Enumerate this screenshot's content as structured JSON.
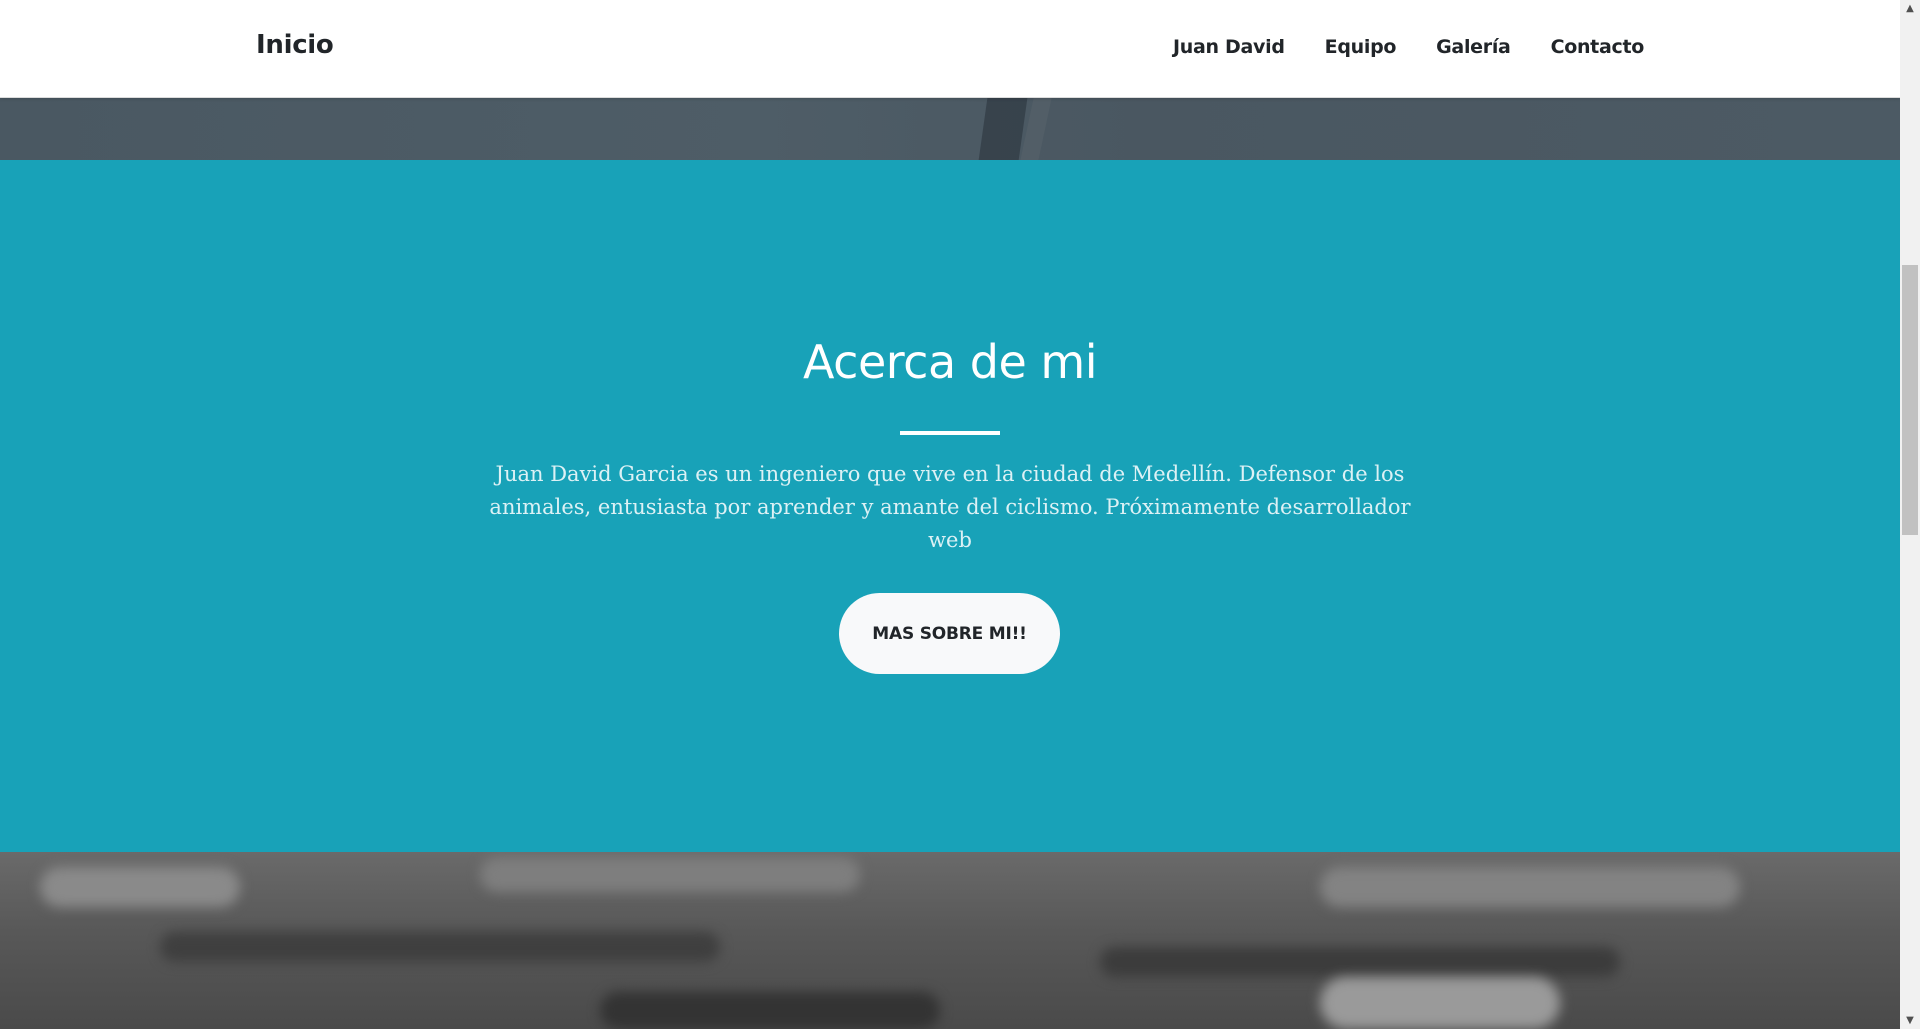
{
  "navbar": {
    "brand": "Inicio",
    "links": [
      "Juan David",
      "Equipo",
      "Galería",
      "Contacto"
    ]
  },
  "about": {
    "title": "Acerca de mi",
    "text": "Juan David Garcia es un ingeniero que vive en la ciudad de Medellín. Defensor de los animales, entusiasta por aprender y amante del ciclismo. Próximamente desarrollador web",
    "button_label": "MAS SOBRE MI!!"
  },
  "colors": {
    "section_bg": "#18a2b8",
    "button_bg": "#f8f9fa",
    "text_dark": "#212529"
  },
  "icons": {
    "scroll_up": "chevron-up-icon",
    "scroll_down": "chevron-down-icon"
  }
}
